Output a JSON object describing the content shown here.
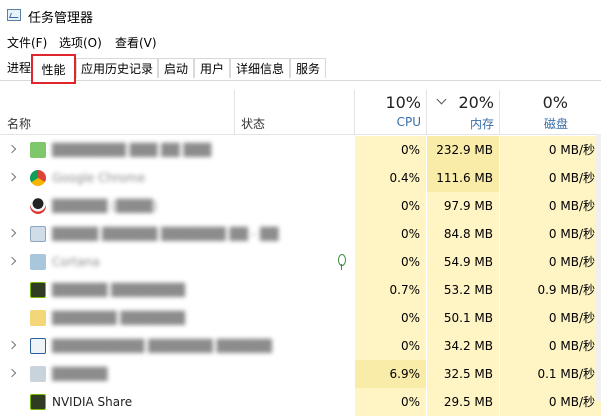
{
  "window": {
    "title": "任务管理器",
    "icon": "task-manager-icon"
  },
  "menu": [
    "文件(F)",
    "选项(O)",
    "查看(V)"
  ],
  "tabs": [
    "进程",
    "性能",
    "应用历史记录",
    "启动",
    "用户",
    "详细信息",
    "服务"
  ],
  "active_tab": "性能",
  "columns": {
    "name": "名称",
    "status": "状态",
    "cpu": {
      "pct": "10%",
      "label": "CPU"
    },
    "memory": {
      "pct": "20%",
      "label": "内存"
    },
    "disk": {
      "pct": "0%",
      "label": "磁盘"
    }
  },
  "sorted_column": "memory",
  "colors": {
    "usage_light": "#fff4c4",
    "usage_dark": "#f9eca8",
    "highlight_box": "#e0262a",
    "header_sub": "#3a6ea5"
  },
  "processes": [
    {
      "name": "",
      "expandable": true,
      "icon": "green-app-icon",
      "cpu": "0%",
      "memory": "232.9 MB",
      "disk": "0 MB/秒",
      "status_icon": ""
    },
    {
      "name": "Google Chrome",
      "expandable": true,
      "icon": "chrome-icon",
      "cpu": "0.4%",
      "memory": "111.6 MB",
      "disk": "0 MB/秒",
      "status_icon": ""
    },
    {
      "name": "",
      "expandable": false,
      "icon": "qq-penguin-icon",
      "cpu": "0%",
      "memory": "97.9 MB",
      "disk": "0 MB/秒",
      "status_icon": ""
    },
    {
      "name": "",
      "expandable": true,
      "icon": "app-window-icon",
      "cpu": "0%",
      "memory": "84.8 MB",
      "disk": "0 MB/秒",
      "status_icon": ""
    },
    {
      "name": "Cortana",
      "expandable": true,
      "icon": "cortana-icon",
      "cpu": "0%",
      "memory": "54.9 MB",
      "disk": "0 MB/秒",
      "status_icon": "leaf-icon"
    },
    {
      "name": "",
      "expandable": false,
      "icon": "nvidia-icon",
      "cpu": "0.7%",
      "memory": "53.2 MB",
      "disk": "0.9 MB/秒",
      "status_icon": ""
    },
    {
      "name": "",
      "expandable": false,
      "icon": "windows-folder-icon",
      "cpu": "0%",
      "memory": "50.1 MB",
      "disk": "0 MB/秒",
      "status_icon": ""
    },
    {
      "name": "",
      "expandable": true,
      "icon": "blue-window-icon",
      "cpu": "0%",
      "memory": "34.2 MB",
      "disk": "0 MB/秒",
      "status_icon": ""
    },
    {
      "name": "",
      "expandable": true,
      "icon": "gray-app-icon",
      "cpu": "6.9%",
      "memory": "32.5 MB",
      "disk": "0.1 MB/秒",
      "status_icon": ""
    },
    {
      "name": "NVIDIA Share",
      "expandable": false,
      "icon": "nvidia-icon",
      "cpu": "0%",
      "memory": "29.5 MB",
      "disk": "0 MB/秒",
      "status_icon": ""
    }
  ]
}
